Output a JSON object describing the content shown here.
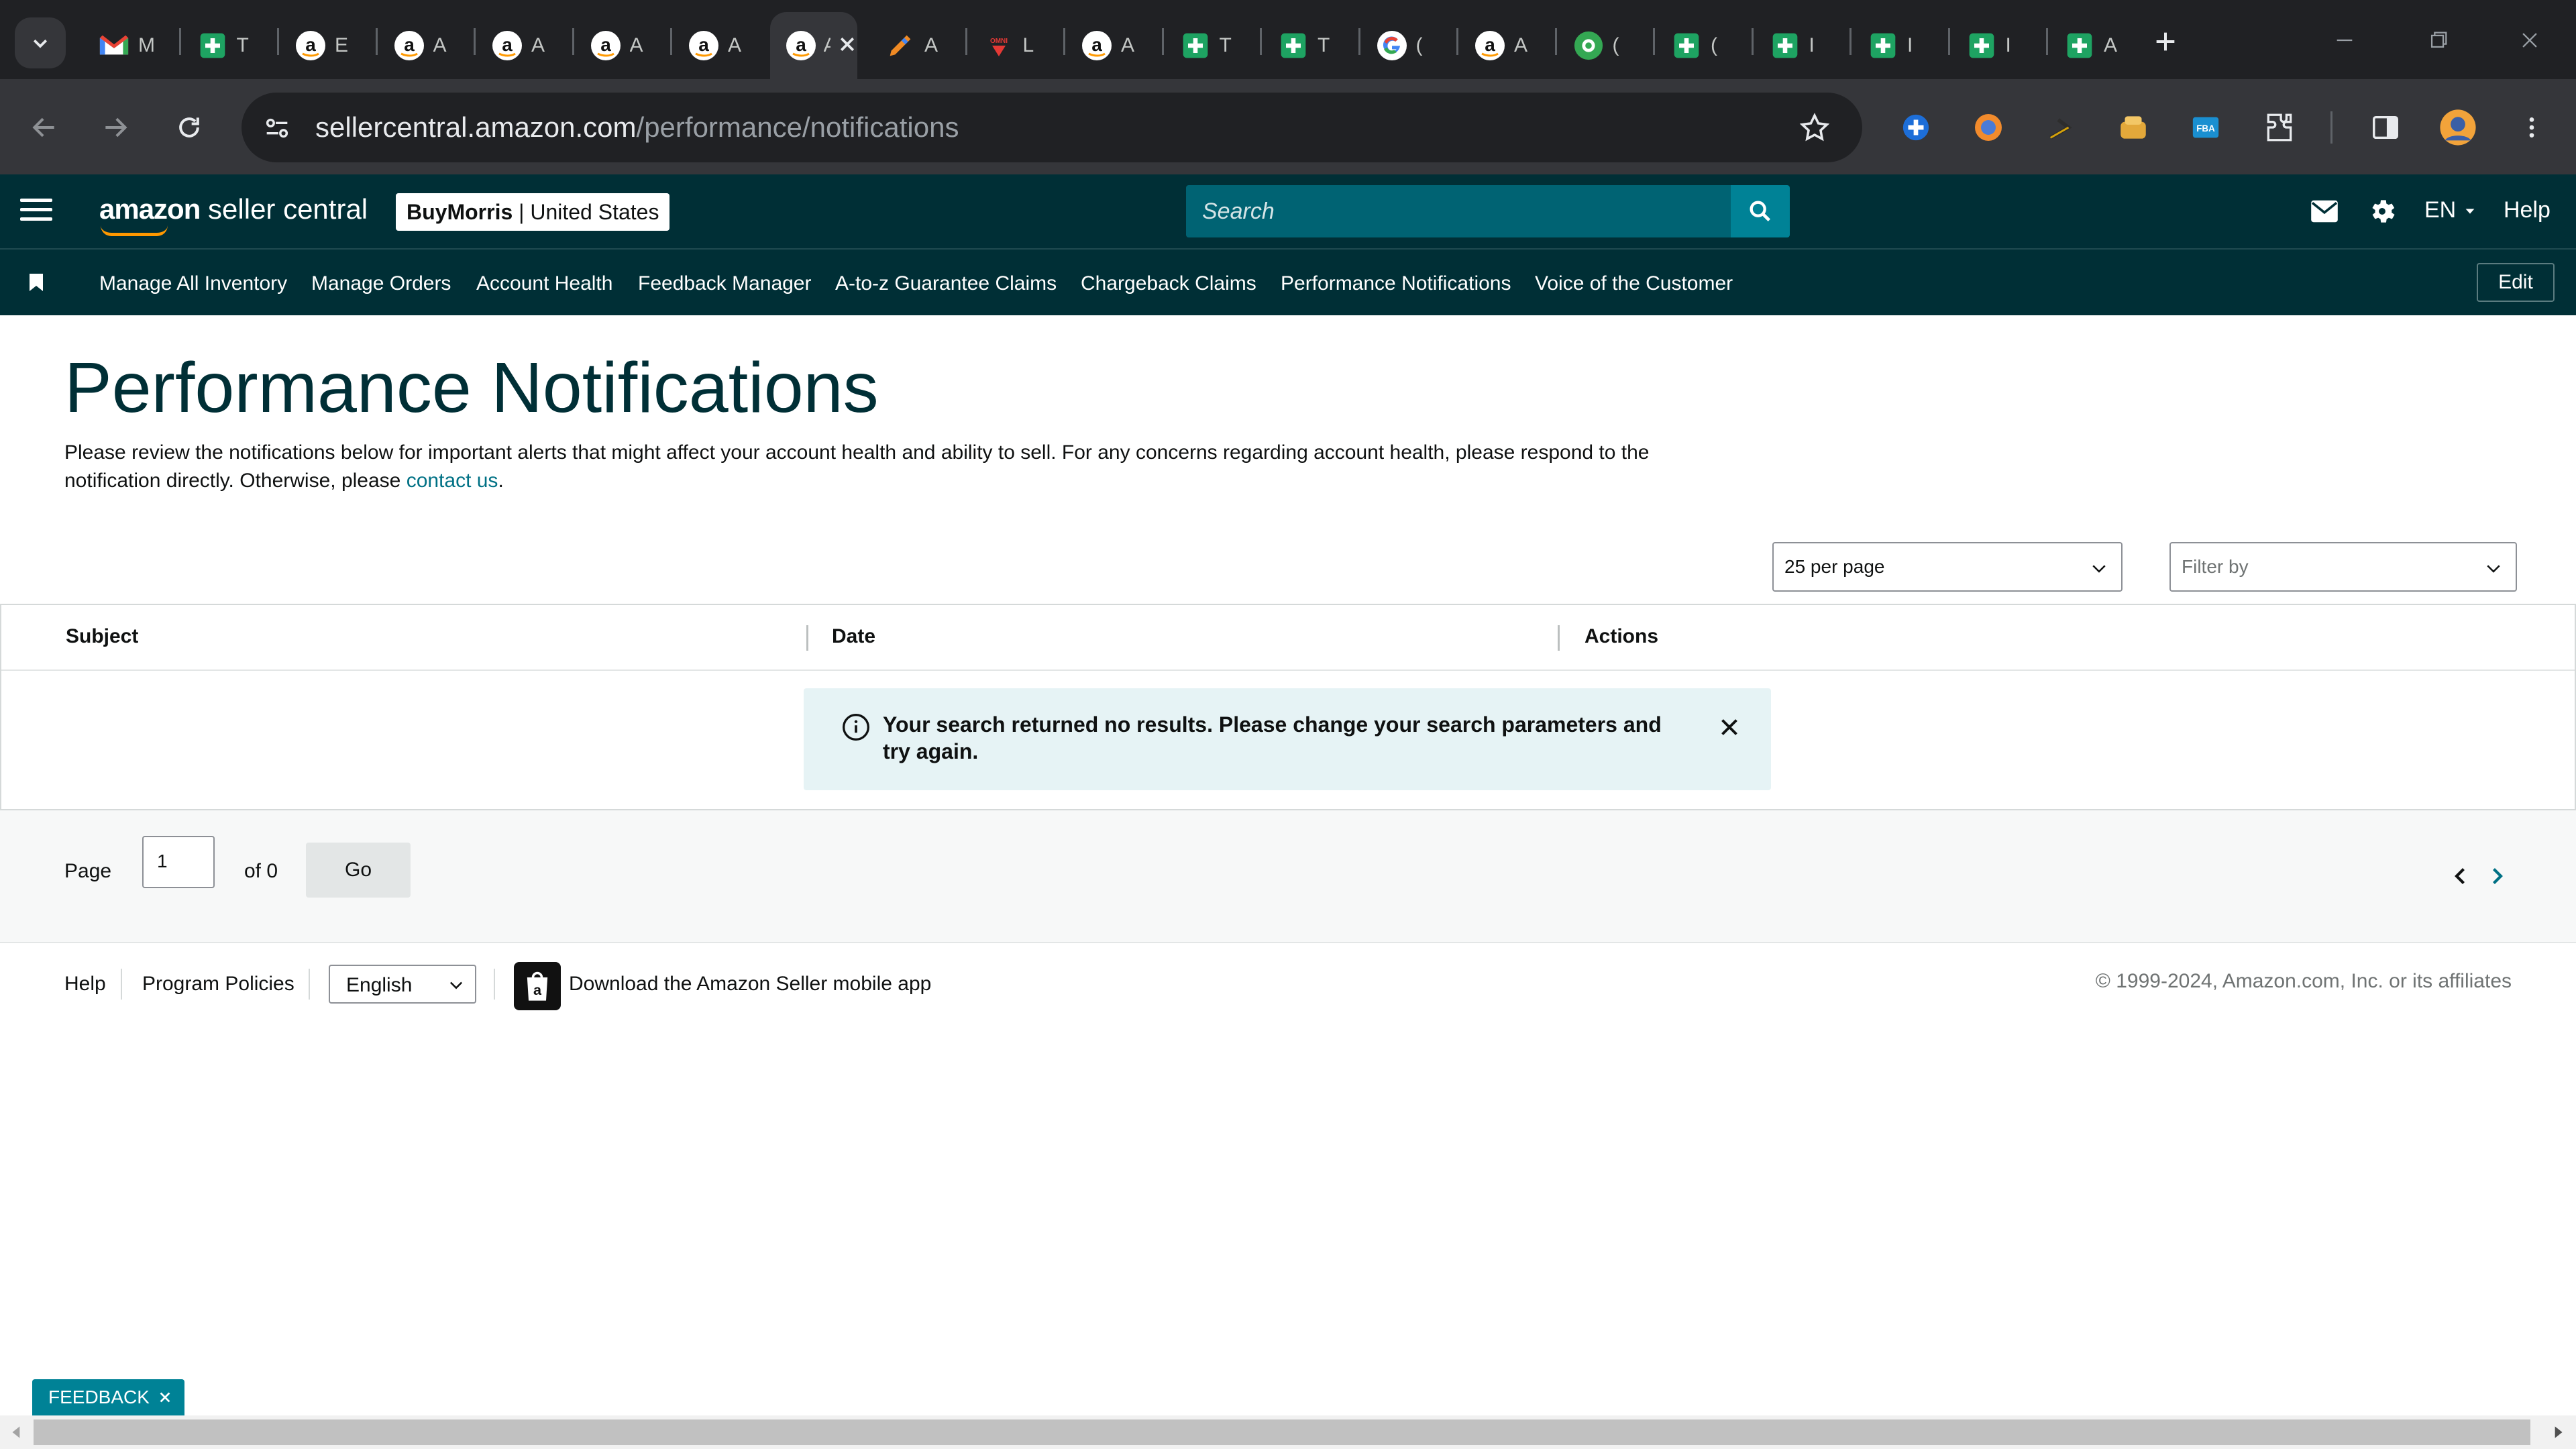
{
  "browser": {
    "tabs": [
      {
        "icon": "gmail-icon",
        "title": "M"
      },
      {
        "icon": "sheets-icon",
        "title": "T"
      },
      {
        "icon": "amazon-icon",
        "title": "E"
      },
      {
        "icon": "amazon-icon",
        "title": "A"
      },
      {
        "icon": "amazon-icon",
        "title": "A"
      },
      {
        "icon": "amazon-icon",
        "title": "A"
      },
      {
        "icon": "amazon-icon",
        "title": "A"
      },
      {
        "icon": "amazon-icon",
        "title": "A",
        "active": true
      },
      {
        "icon": "pen-icon",
        "title": "A"
      },
      {
        "icon": "logo-red-icon",
        "title": "L"
      },
      {
        "icon": "amazon-icon",
        "title": "A"
      },
      {
        "icon": "sheets-icon",
        "title": "T"
      },
      {
        "icon": "sheets-icon",
        "title": "T"
      },
      {
        "icon": "google-icon",
        "title": "("
      },
      {
        "icon": "amazon-icon",
        "title": "A"
      },
      {
        "icon": "green-circle-icon",
        "title": "("
      },
      {
        "icon": "sheets-icon",
        "title": "("
      },
      {
        "icon": "sheets-icon",
        "title": "I"
      },
      {
        "icon": "sheets-icon",
        "title": "I"
      },
      {
        "icon": "sheets-icon",
        "title": "I"
      },
      {
        "icon": "sheets-icon",
        "title": "A"
      }
    ],
    "url_host": "sellercentral.amazon.com",
    "url_path": "/performance/notifications"
  },
  "header": {
    "logo_brand": "amazon",
    "logo_product": " seller central",
    "store_name": "BuyMorris",
    "store_sep": " | ",
    "store_region": "United States",
    "search_placeholder": "Search",
    "language": "EN",
    "help": "Help"
  },
  "nav": {
    "links": [
      "Manage All Inventory",
      "Manage Orders",
      "Account Health",
      "Feedback Manager",
      "A-to-z Guarantee Claims",
      "Chargeback Claims",
      "Performance Notifications",
      "Voice of the Customer"
    ],
    "edit": "Edit"
  },
  "main": {
    "title": "Performance Notifications",
    "intro_text": "Please review the notifications below for important alerts that might affect your account health and ability to sell. For any concerns regarding account health, please respond to the notification directly. Otherwise, please ",
    "intro_link": "contact us",
    "intro_end": ".",
    "per_page_value": "25 per page",
    "filter_placeholder": "Filter by",
    "columns": [
      "Subject",
      "Date",
      "Actions"
    ],
    "empty_message": "Your search returned no results. Please change your search parameters and try again."
  },
  "pager": {
    "page_label": "Page",
    "page_value": "1",
    "of_label": "of 0",
    "go": "Go"
  },
  "footer": {
    "help": "Help",
    "policies": "Program Policies",
    "language": "English",
    "app_download": "Download the Amazon Seller mobile app",
    "copyright": "© 1999-2024, Amazon.com, Inc. or its affiliates"
  },
  "feedback": {
    "label": "FEEDBACK"
  },
  "colors": {
    "header_bg": "#002f36",
    "search_bg": "#006373",
    "search_btn": "#008296",
    "link": "#007185",
    "alert_bg": "#e6f3f5"
  }
}
